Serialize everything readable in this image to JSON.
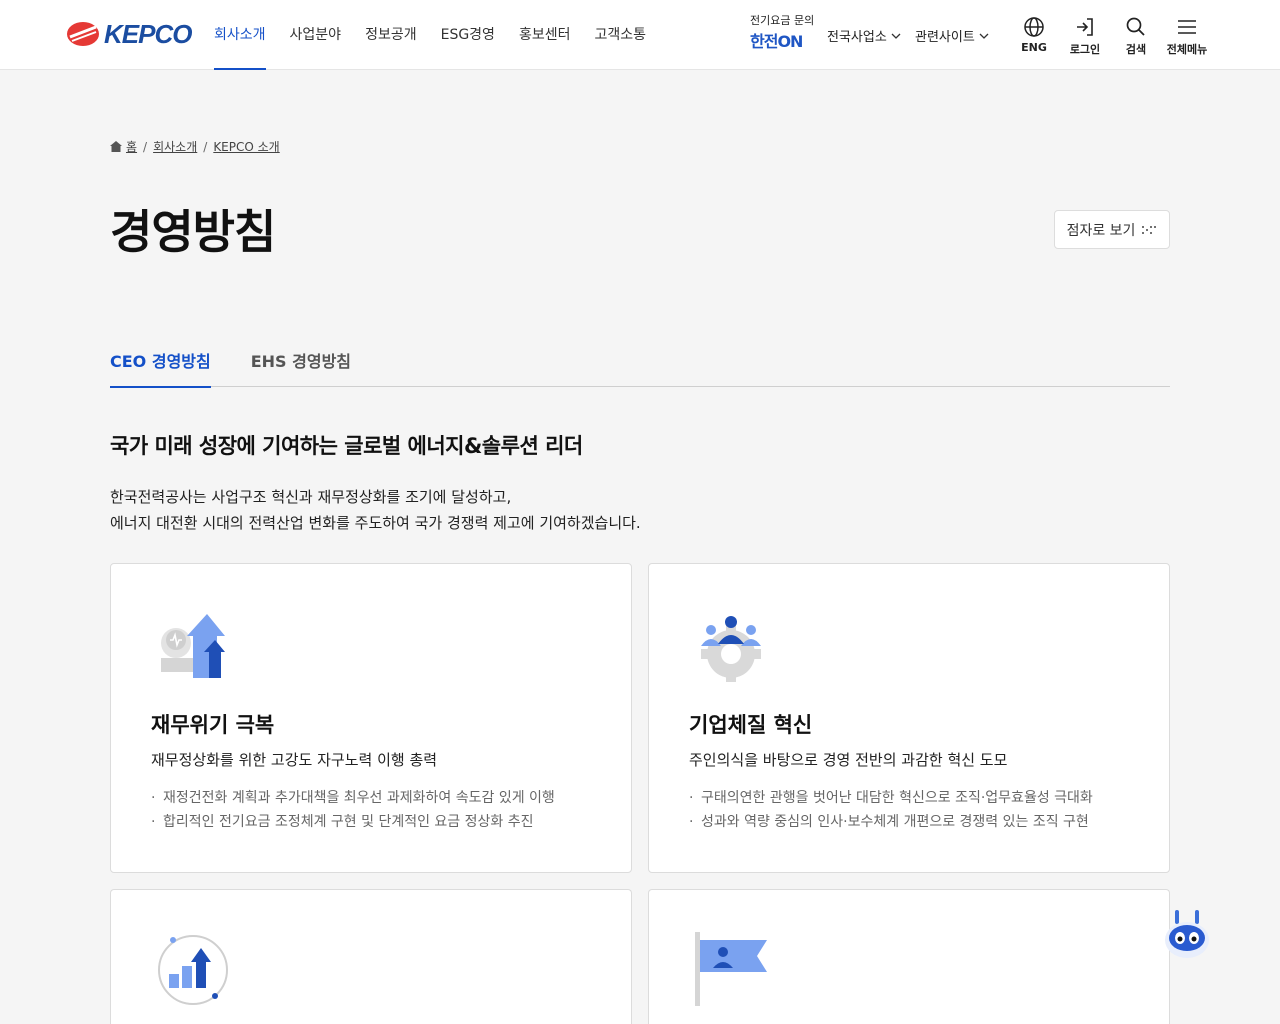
{
  "header": {
    "logo_text": "KEPCO",
    "nav": [
      "회사소개",
      "사업분야",
      "정보공개",
      "ESG경영",
      "홍보센터",
      "고객소통"
    ],
    "hanjeon_small": "전기요금 문의",
    "hanjeon_big": "한전ON",
    "drop1": "전국사업소",
    "drop2": "관련사이트",
    "util": {
      "eng": "ENG",
      "login": "로그인",
      "search": "검색",
      "menu": "전체메뉴"
    }
  },
  "breadcrumb": {
    "home": "홈",
    "level1": "회사소개",
    "level2": "KEPCO 소개"
  },
  "page_title": "경영방침",
  "braille_label": "점자로 보기",
  "tabs": [
    "CEO 경영방침",
    "EHS 경영방침"
  ],
  "section_title": "국가 미래 성장에 기여하는 글로벌 에너지&솔루션 리더",
  "intro": [
    "한국전력공사는 사업구조 혁신과 재무정상화를 조기에 달성하고,",
    "에너지 대전환 시대의 전력산업 변화를 주도하여 국가 경쟁력 제고에 기여하겠습니다."
  ],
  "cards": [
    {
      "icon": "financial-growth-icon",
      "title": "재무위기 극복",
      "subtitle": "재무정상화를 위한 고강도 자구노력 이행 총력",
      "items": [
        "재정건전화 계획과 추가대책을 최우선 과제화하여 속도감 있게 이행",
        "합리적인 전기요금 조정체계 구현 및 단계적인 요금 정상화 추진"
      ]
    },
    {
      "icon": "team-gear-icon",
      "title": "기업체질 혁신",
      "subtitle": "주인의식을 바탕으로 경영 전반의 과감한 혁신 도모",
      "items": [
        "구태의연한 관행을 벗어난 대담한 혁신으로 조직·업무효율성 극대화",
        "성과와 역량 중심의 인사·보수체계 개편으로 경쟁력 있는 조직 구현"
      ]
    }
  ],
  "colors": {
    "accent": "#1450c8",
    "text": "#111111",
    "bg": "#f5f5f5"
  }
}
